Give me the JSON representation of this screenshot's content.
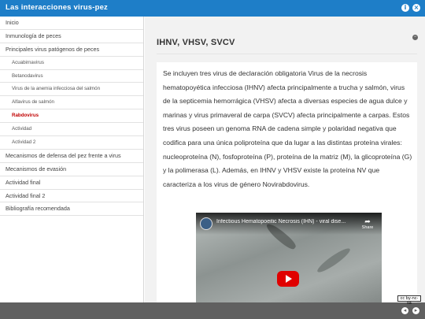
{
  "header": {
    "title": "Las interacciones virus-pez",
    "info_icon": "info-icon",
    "close_icon": "close-icon"
  },
  "sidebar": {
    "items": [
      {
        "label": "Inicio",
        "level": 1
      },
      {
        "label": "Inmunología de peces",
        "level": 1
      },
      {
        "label": "Principales virus patógenos de peces",
        "level": 1
      },
      {
        "label": "Acuabirnavirus",
        "level": 2
      },
      {
        "label": "Betanodavirus",
        "level": 2
      },
      {
        "label": "Virus de la anemia infecciosa del salmón",
        "level": 2
      },
      {
        "label": "Alfavirus de salmón",
        "level": 2
      },
      {
        "label": "Rabdovirus",
        "level": 2,
        "active": true
      },
      {
        "label": "Actividad",
        "level": 2
      },
      {
        "label": "Actividad 2",
        "level": 2
      },
      {
        "label": "Mecanismos de defensa del pez frente a virus",
        "level": 1
      },
      {
        "label": "Mecanismos de evasión",
        "level": 1
      },
      {
        "label": "Actividad final",
        "level": 1
      },
      {
        "label": "Actividad final 2",
        "level": 1
      },
      {
        "label": "Bibliografía recomendada",
        "level": 1
      }
    ]
  },
  "content": {
    "heading": "IHNV, VHSV, SVCV",
    "paragraph": "Se incluyen tres virus de declaración obligatoria Virus de la necrosis hematopoyética infecciosa (IHNV) afecta principalmente a trucha y salmón, virus de la septicemia hemorrágica (VHSV) afecta a diversas especies de agua dulce y marinas y virus primaveral de carpa (SVCV) afecta principalmente a carpas. Estos tres virus poseen un genoma RNA de cadena simple y polaridad negativa que codifica para una única poliproteína que da lugar a las distintas proteína virales: nucleoproteína (N), fosfoproteína (P), proteína de la matriz (M), la glicoproteína (G) y la polimerasa (L). Además, en IHNV y VHSV existe la proteína  NV que caracteriza a los virus de género Novirabdovirus.",
    "video": {
      "title": "Infectious Hematopoeitic Necrosis (IHN) - viral dise...",
      "share_label": "Share"
    }
  },
  "footer": {
    "license_badge": "cc by-nc-sa",
    "prev_icon": "previous-page-icon",
    "next_icon": "next-page-icon"
  },
  "colors": {
    "header_bg": "#1e7ec8",
    "footer_bg": "#606060",
    "active_link": "#c00000",
    "play_button": "#e00000"
  }
}
